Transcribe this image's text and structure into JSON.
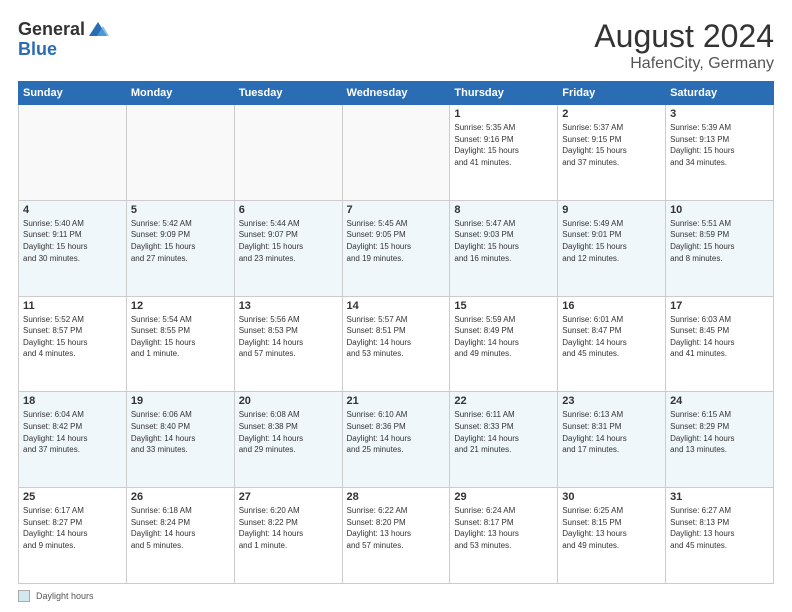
{
  "header": {
    "logo_general": "General",
    "logo_blue": "Blue",
    "title": "August 2024",
    "location": "HafenCity, Germany"
  },
  "footer": {
    "legend_label": "Daylight hours"
  },
  "calendar": {
    "days_of_week": [
      "Sunday",
      "Monday",
      "Tuesday",
      "Wednesday",
      "Thursday",
      "Friday",
      "Saturday"
    ],
    "weeks": [
      [
        {
          "day": "",
          "info": ""
        },
        {
          "day": "",
          "info": ""
        },
        {
          "day": "",
          "info": ""
        },
        {
          "day": "",
          "info": ""
        },
        {
          "day": "1",
          "info": "Sunrise: 5:35 AM\nSunset: 9:16 PM\nDaylight: 15 hours\nand 41 minutes."
        },
        {
          "day": "2",
          "info": "Sunrise: 5:37 AM\nSunset: 9:15 PM\nDaylight: 15 hours\nand 37 minutes."
        },
        {
          "day": "3",
          "info": "Sunrise: 5:39 AM\nSunset: 9:13 PM\nDaylight: 15 hours\nand 34 minutes."
        }
      ],
      [
        {
          "day": "4",
          "info": "Sunrise: 5:40 AM\nSunset: 9:11 PM\nDaylight: 15 hours\nand 30 minutes."
        },
        {
          "day": "5",
          "info": "Sunrise: 5:42 AM\nSunset: 9:09 PM\nDaylight: 15 hours\nand 27 minutes."
        },
        {
          "day": "6",
          "info": "Sunrise: 5:44 AM\nSunset: 9:07 PM\nDaylight: 15 hours\nand 23 minutes."
        },
        {
          "day": "7",
          "info": "Sunrise: 5:45 AM\nSunset: 9:05 PM\nDaylight: 15 hours\nand 19 minutes."
        },
        {
          "day": "8",
          "info": "Sunrise: 5:47 AM\nSunset: 9:03 PM\nDaylight: 15 hours\nand 16 minutes."
        },
        {
          "day": "9",
          "info": "Sunrise: 5:49 AM\nSunset: 9:01 PM\nDaylight: 15 hours\nand 12 minutes."
        },
        {
          "day": "10",
          "info": "Sunrise: 5:51 AM\nSunset: 8:59 PM\nDaylight: 15 hours\nand 8 minutes."
        }
      ],
      [
        {
          "day": "11",
          "info": "Sunrise: 5:52 AM\nSunset: 8:57 PM\nDaylight: 15 hours\nand 4 minutes."
        },
        {
          "day": "12",
          "info": "Sunrise: 5:54 AM\nSunset: 8:55 PM\nDaylight: 15 hours\nand 1 minute."
        },
        {
          "day": "13",
          "info": "Sunrise: 5:56 AM\nSunset: 8:53 PM\nDaylight: 14 hours\nand 57 minutes."
        },
        {
          "day": "14",
          "info": "Sunrise: 5:57 AM\nSunset: 8:51 PM\nDaylight: 14 hours\nand 53 minutes."
        },
        {
          "day": "15",
          "info": "Sunrise: 5:59 AM\nSunset: 8:49 PM\nDaylight: 14 hours\nand 49 minutes."
        },
        {
          "day": "16",
          "info": "Sunrise: 6:01 AM\nSunset: 8:47 PM\nDaylight: 14 hours\nand 45 minutes."
        },
        {
          "day": "17",
          "info": "Sunrise: 6:03 AM\nSunset: 8:45 PM\nDaylight: 14 hours\nand 41 minutes."
        }
      ],
      [
        {
          "day": "18",
          "info": "Sunrise: 6:04 AM\nSunset: 8:42 PM\nDaylight: 14 hours\nand 37 minutes."
        },
        {
          "day": "19",
          "info": "Sunrise: 6:06 AM\nSunset: 8:40 PM\nDaylight: 14 hours\nand 33 minutes."
        },
        {
          "day": "20",
          "info": "Sunrise: 6:08 AM\nSunset: 8:38 PM\nDaylight: 14 hours\nand 29 minutes."
        },
        {
          "day": "21",
          "info": "Sunrise: 6:10 AM\nSunset: 8:36 PM\nDaylight: 14 hours\nand 25 minutes."
        },
        {
          "day": "22",
          "info": "Sunrise: 6:11 AM\nSunset: 8:33 PM\nDaylight: 14 hours\nand 21 minutes."
        },
        {
          "day": "23",
          "info": "Sunrise: 6:13 AM\nSunset: 8:31 PM\nDaylight: 14 hours\nand 17 minutes."
        },
        {
          "day": "24",
          "info": "Sunrise: 6:15 AM\nSunset: 8:29 PM\nDaylight: 14 hours\nand 13 minutes."
        }
      ],
      [
        {
          "day": "25",
          "info": "Sunrise: 6:17 AM\nSunset: 8:27 PM\nDaylight: 14 hours\nand 9 minutes."
        },
        {
          "day": "26",
          "info": "Sunrise: 6:18 AM\nSunset: 8:24 PM\nDaylight: 14 hours\nand 5 minutes."
        },
        {
          "day": "27",
          "info": "Sunrise: 6:20 AM\nSunset: 8:22 PM\nDaylight: 14 hours\nand 1 minute."
        },
        {
          "day": "28",
          "info": "Sunrise: 6:22 AM\nSunset: 8:20 PM\nDaylight: 13 hours\nand 57 minutes."
        },
        {
          "day": "29",
          "info": "Sunrise: 6:24 AM\nSunset: 8:17 PM\nDaylight: 13 hours\nand 53 minutes."
        },
        {
          "day": "30",
          "info": "Sunrise: 6:25 AM\nSunset: 8:15 PM\nDaylight: 13 hours\nand 49 minutes."
        },
        {
          "day": "31",
          "info": "Sunrise: 6:27 AM\nSunset: 8:13 PM\nDaylight: 13 hours\nand 45 minutes."
        }
      ]
    ]
  }
}
